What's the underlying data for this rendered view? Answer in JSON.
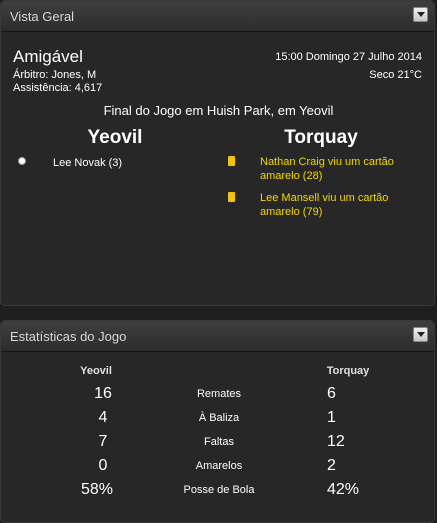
{
  "overview": {
    "title": "Vista Geral",
    "match_type": "Amigável",
    "referee": "Árbitro: Jones, M",
    "attendance": "Assistência: 4,617",
    "datetime": "15:00 Domingo 27 Julho 2014",
    "weather": "Seco 21°C",
    "result_text": "Final do Jogo em Huish Park, em Yeovil",
    "home_team": "Yeovil",
    "away_team": "Torquay",
    "home_events": [
      {
        "icon": "goal-ball-icon",
        "text": "Lee Novak (3)"
      }
    ],
    "away_events": [
      {
        "icon": "yellow-card-icon",
        "text": "Nathan Craig viu um cartão amarelo (28)"
      },
      {
        "icon": "yellow-card-icon",
        "text": "Lee Mansell viu um cartão amarelo (79)"
      }
    ]
  },
  "stats": {
    "title": "Estatísticas do Jogo",
    "home_team": "Yeovil",
    "away_team": "Torquay",
    "rows": [
      {
        "label": "Remates",
        "home": "16",
        "away": "6"
      },
      {
        "label": "À Baliza",
        "home": "4",
        "away": "1"
      },
      {
        "label": "Faltas",
        "home": "7",
        "away": "12"
      },
      {
        "label": "Amarelos",
        "home": "0",
        "away": "2"
      },
      {
        "label": "Posse de Bola",
        "home": "58%",
        "away": "42%"
      }
    ]
  },
  "colors": {
    "card_yellow": "#f2c500",
    "event_yellow_text": "#f2d600",
    "panel_bg": "#272727"
  }
}
